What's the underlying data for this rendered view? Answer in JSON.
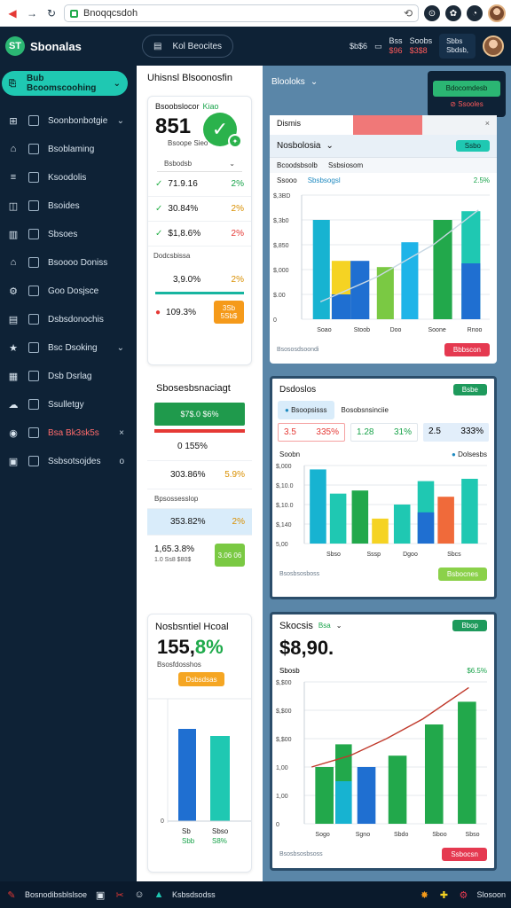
{
  "browser": {
    "url": "Bnoqqcsdoh",
    "icons": [
      "back-icon",
      "forward-icon",
      "reload-icon"
    ]
  },
  "brand": {
    "name": "Sbonalas",
    "logo": "ST"
  },
  "sidebar": {
    "cta": "Bub Bcoomscoohing",
    "items": [
      {
        "label": "Soonbonbotgie",
        "icon": "grid-icon",
        "tail": "⌄"
      },
      {
        "label": "Bsoblaming",
        "icon": "store-icon",
        "tail": ""
      },
      {
        "label": "Ksoodolis",
        "icon": "list-icon",
        "tail": ""
      },
      {
        "label": "Bsoides",
        "icon": "chart-icon",
        "tail": ""
      },
      {
        "label": "Sbsoes",
        "icon": "table-icon",
        "tail": ""
      },
      {
        "label": "Bsoooo Doniss",
        "icon": "home-icon",
        "tail": ""
      },
      {
        "label": "Goo Dosjsce",
        "icon": "settings-icon",
        "tail": ""
      },
      {
        "label": "Dsbsdonochis",
        "icon": "doc-icon",
        "tail": ""
      },
      {
        "label": "Bsc Dsoking",
        "icon": "star-icon",
        "tail": "⌄"
      },
      {
        "label": "Dsb Dsrlag",
        "icon": "folder-icon",
        "tail": ""
      },
      {
        "label": "Ssulletgy",
        "icon": "cloud-icon",
        "tail": ""
      },
      {
        "label": "Bsa Bk3sk5s",
        "icon": "alert-icon",
        "tail": "×"
      },
      {
        "label": "Ssbsotsojdes",
        "icon": "box-icon",
        "tail": "o"
      }
    ]
  },
  "topbar": {
    "pill": "Kol Beocites",
    "s1": "$b$6",
    "s2a": "Bss",
    "s2b": "$96",
    "s3a": "Soobs",
    "s3b": "$3$8",
    "user1": "Sbbs",
    "user2": "Sbdsb,"
  },
  "leftcol": {
    "title": "Uhisnsl Blsoonosfin",
    "card1": {
      "head": "Bsoobslocor",
      "head_green": "Kiao",
      "big": "851",
      "sub": "Bsoope Sieo",
      "dropdown": "Bsbodsb",
      "rows": [
        {
          "value": "71.9.16",
          "pct": "2%"
        },
        {
          "value": "30.84%",
          "pct": "2%"
        },
        {
          "value": "$1,8.6%",
          "pct": "2%"
        }
      ],
      "mid": "Dodcsbissa",
      "row4": {
        "value": "3,9.0%",
        "pct": "2%"
      },
      "row5": {
        "value": "109.3%",
        "pill": "3Sb 5Sb$"
      }
    },
    "card2": {
      "title": "Sbosesbsnaciagt",
      "banner": "$7$.0 $6%",
      "rows": [
        {
          "value": "0 155%"
        },
        {
          "value": "303.86%",
          "pct": "5.9%"
        },
        {
          "value": "Bpsossesslop",
          "pct": ""
        },
        {
          "value": "353.82%",
          "pct": "2%"
        },
        {
          "value": "1,65.3.8%",
          "sub": "1.0 Ss8 $80$",
          "pill": "3.06 06"
        }
      ]
    },
    "card3": {
      "title": "Nosbsntiel Hcoal",
      "big": "155,",
      "big_green": "8%",
      "sub": "Bsosfdosshos",
      "button": "Dsbsdsas",
      "chart": {
        "labels": [
          "Sb",
          "Sbso"
        ],
        "sublabels": [
          "Sbb",
          "S8%"
        ]
      }
    }
  },
  "rightcol": {
    "head": "Blooloks",
    "action_top": "Bdocomdesb",
    "action_bottom": "Ssooles",
    "panel1": {
      "tabs": [
        "Dismis",
        "Nosbolosia",
        "Ssbsiosom"
      ],
      "tabbar": "Bcoodsbsolb",
      "button": "Ssbo",
      "label_left": "Ssooo",
      "label_mid": "Sbsbsogsl",
      "pct": "2.5%",
      "footer": "Bsososdsoondi",
      "footer_btn": "Bbbscon"
    },
    "panel2": {
      "title": "Dsdoslos",
      "button": "Bsbe",
      "tab_a": "Bsoopsisss",
      "tab_b": "Bosobsnsinciie",
      "kpis": [
        {
          "a": "3.5",
          "b": "335%"
        },
        {
          "a": "1.28",
          "b": "31%"
        },
        {
          "a": "2.5",
          "b": "333%"
        }
      ],
      "label": "Soobn",
      "legend": "Dolsesbs",
      "footer": "Bsosbsosboss",
      "footer_btn": "Bsbocnes"
    },
    "panel3": {
      "title": "Skocsis",
      "title_tag": "Bsa",
      "button": "Bbop",
      "big": "$8,90.",
      "label": "Sbosb",
      "pct": "$6.5%",
      "footer": "Bsosbsosbsoss",
      "footer_btn": "Ssbocsn"
    }
  },
  "taskbar": {
    "left": "Bosnodibsblslsoe",
    "mid": "Ksbsdsodss",
    "right": "Slosoon"
  },
  "chart_data": [
    {
      "type": "bar",
      "categories": [
        "Soao",
        "Stoob",
        "Doo",
        "Soone",
        "Rnoo"
      ],
      "series": [
        {
          "values": [
            26,
            7,
            16,
            15,
            21,
            26,
            22
          ]
        }
      ],
      "yticks": [
        "$,3BD",
        "$,3b0",
        "$,850",
        "$,000",
        "$.00",
        "0"
      ],
      "colors": [
        "#17b3d1",
        "#f5d323",
        "#1f6fd1",
        "#7ac943",
        "#1fb4e8",
        "#22a84b",
        "#1fc8b2",
        "#1f6fd1"
      ]
    },
    {
      "type": "bar",
      "categories": [
        "Sbso",
        "Sssp",
        "Dgoo",
        "Sbcs"
      ],
      "yticks": [
        "$,000",
        "$,10.0",
        "$,10.0",
        "$,140",
        "5,00"
      ],
      "colors": [
        "#17b3d1",
        "#1fc8b2",
        "#22a84b",
        "#f5d323",
        "#1fc8b2",
        "#1f6fd1",
        "#f06a3a",
        "#1fc8b2"
      ]
    },
    {
      "type": "bar",
      "categories": [
        "Sogo",
        "Sgno",
        "Sbdo",
        "Sboo",
        "Sbso"
      ],
      "yticks": [
        "$,$00",
        "$,$00",
        "$,$00",
        "1,00",
        "1,00",
        "0"
      ],
      "colors": [
        "#22a84b",
        "#17b3d1",
        "#1f6fd1",
        "#22a84b",
        "#22a84b",
        "#22a84b"
      ]
    }
  ]
}
